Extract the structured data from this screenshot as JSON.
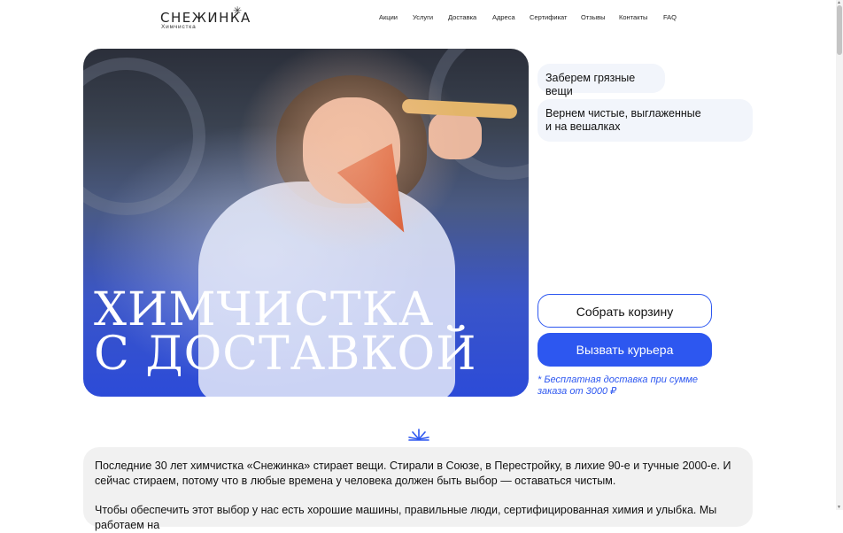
{
  "logo": {
    "name": "СНЕЖИНКА",
    "subtitle": "Химчистка",
    "star": "✳"
  },
  "nav": [
    "Акции",
    "Услуги",
    "Доставка",
    "Адреса",
    "Сертификат",
    "Отзывы",
    "Контакты",
    "FAQ"
  ],
  "hero": {
    "title_line1": "ХИМЧИСТКА",
    "title_line2": "С ДОСТАВКОЙ"
  },
  "bubbles": {
    "pickup": "Заберем грязные вещи",
    "return_line1": "Вернем чистые, выглаженные",
    "return_line2": "и на вешалках"
  },
  "buttons": {
    "cart": "Собрать корзину",
    "courier": "Вызвать курьера"
  },
  "note": "* Бесплатная доставка при сумме заказа от 3000 ₽",
  "about": {
    "p1": "Последние 30 лет химчистка «Снежинка» стирает вещи. Стирали в Союзе, в Перестройку, в лихие 90-е и тучные 2000-е. И сейчас стираем, потому что в любые времена у человека должен быть выбор — оставаться чистым.",
    "p2": "Чтобы обеспечить этот выбор у нас есть хорошие машины, правильные люди, сертифицированная химия и улыбка. Мы работаем на"
  },
  "colors": {
    "accent": "#2d57f0",
    "bubble_bg": "#f2f5fb",
    "about_bg": "#f1f1f1"
  },
  "icons": {
    "divider": "snowflake-burst-icon"
  }
}
